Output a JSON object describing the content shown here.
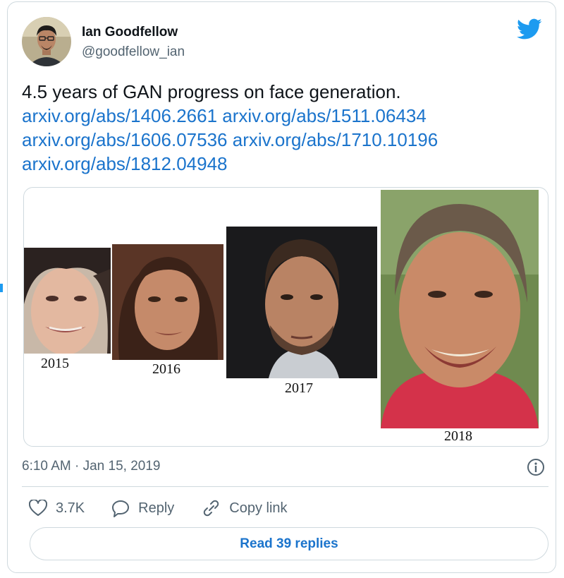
{
  "author": {
    "name": "Ian Goodfellow",
    "handle": "@goodfellow_ian"
  },
  "tweet": {
    "text": "4.5 years of GAN progress on face generation.",
    "links": [
      "arxiv.org/abs/1406.2661",
      "arxiv.org/abs/1511.06434",
      "arxiv.org/abs/1606.07536",
      "arxiv.org/abs/1710.10196",
      "arxiv.org/abs/1812.04948"
    ]
  },
  "media": {
    "years": [
      "2015",
      "2016",
      "2017",
      "2018"
    ]
  },
  "timestamp": "6:10 AM · Jan 15, 2019",
  "actions": {
    "likes_count": "3.7K",
    "reply_label": "Reply",
    "copy_link_label": "Copy link"
  },
  "read_replies_label": "Read 39 replies",
  "icons": [
    "bird-icon",
    "info-icon",
    "heart-icon",
    "reply-icon",
    "link-icon"
  ],
  "colors": {
    "link": "#1b74cc",
    "brand_twitter": "#1d9bf0",
    "muted_text": "#536471",
    "border": "#cfd9de"
  }
}
